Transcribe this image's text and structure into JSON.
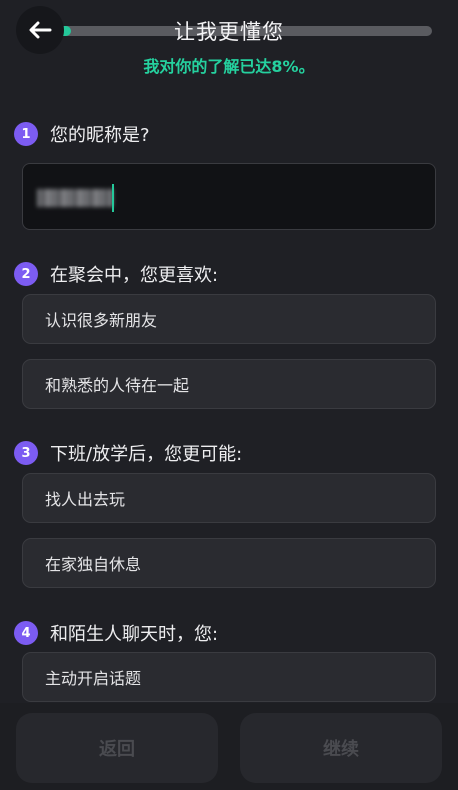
{
  "header": {
    "title": "让我更懂您",
    "subtitle": "我对你的了解已达8%。",
    "progress": 0.08
  },
  "questions": [
    {
      "num": "1",
      "text": "您的昵称是?"
    },
    {
      "num": "2",
      "text": "在聚会中，您更喜欢:",
      "options": [
        "认识很多新朋友",
        "和熟悉的人待在一起"
      ]
    },
    {
      "num": "3",
      "text": "下班/放学后，您更可能:",
      "options": [
        "找人出去玩",
        "在家独自休息"
      ]
    },
    {
      "num": "4",
      "text": "和陌生人聊天时，您:",
      "options": [
        "主动开启话题"
      ]
    }
  ],
  "footer": {
    "back_label": "返回",
    "continue_label": "继续"
  }
}
